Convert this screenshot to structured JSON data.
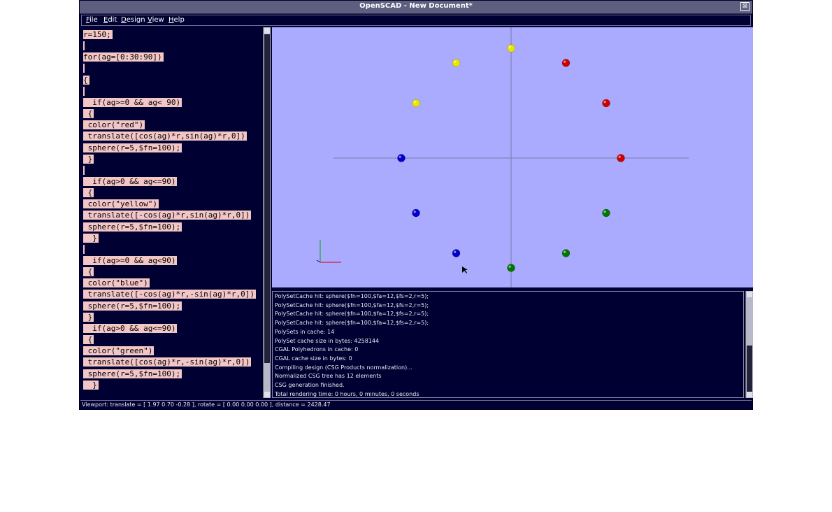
{
  "window": {
    "title": "OpenSCAD - New Document*",
    "close_symbol": "⊠"
  },
  "menu": [
    "File",
    "Edit",
    "Design",
    "View",
    "Help"
  ],
  "editor": {
    "lines": [
      "r=150;",
      "",
      "for(ag=[0:30:90])",
      "",
      "{",
      "",
      "  if(ag>=0 && ag< 90)",
      " {",
      " color(\"red\")",
      " translate([cos(ag)*r,sin(ag)*r,0])",
      " sphere(r=5,$fn=100);",
      " }",
      "",
      "  if(ag>0 && ag<=90)",
      " {",
      " color(\"yellow\")",
      " translate([-cos(ag)*r,sin(ag)*r,0])",
      " sphere(r=5,$fn=100);",
      "  }",
      "",
      "  if(ag>=0 && ag<90)",
      " {",
      " color(\"blue\")",
      " translate([-cos(ag)*r,-sin(ag)*r,0])",
      " sphere(r=5,$fn=100);",
      " }",
      "  if(ag>0 && ag<=90)",
      " {",
      " color(\"green\")",
      " translate([cos(ag)*r,-sin(ag)*r,0])",
      " sphere(r=5,$fn=100);",
      "  }"
    ]
  },
  "viewport": {
    "background": "#aaaaff",
    "spheres": [
      {
        "color": "red",
        "angle_deg": 0
      },
      {
        "color": "red",
        "angle_deg": 30
      },
      {
        "color": "red",
        "angle_deg": 60
      },
      {
        "color": "yellow",
        "angle_deg": 90
      },
      {
        "color": "yellow",
        "angle_deg": 120
      },
      {
        "color": "yellow",
        "angle_deg": 150
      },
      {
        "color": "blue",
        "angle_deg": 180
      },
      {
        "color": "blue",
        "angle_deg": 210
      },
      {
        "color": "blue",
        "angle_deg": 240
      },
      {
        "color": "green",
        "angle_deg": 270
      },
      {
        "color": "green",
        "angle_deg": 300
      },
      {
        "color": "green",
        "angle_deg": 330
      }
    ],
    "colors": {
      "red": "#cc0000",
      "yellow": "#e6e600",
      "blue": "#0000cc",
      "green": "#007700"
    }
  },
  "console": {
    "lines": [
      "PolySetCache hit: sphere($fn=100,$fa=12,$fs=2,r=5);",
      "PolySetCache hit: sphere($fn=100,$fa=12,$fs=2,r=5);",
      "PolySetCache hit: sphere($fn=100,$fa=12,$fs=2,r=5);",
      "PolySetCache hit: sphere($fn=100,$fa=12,$fs=2,r=5);",
      "PolySets in cache: 14",
      "PolySet cache size in bytes: 4258144",
      "CGAL Polyhedrons in cache: 0",
      "CGAL cache size in bytes: 0",
      "Compiling design (CSG Products normalization)...",
      "Normalized CSG tree has 12 elements",
      "CSG generation finished.",
      "Total rendering time: 0 hours, 0 minutes, 0 seconds"
    ]
  },
  "status": {
    "text": "Viewport: translate = [ 1.97 0.70 -0.28 ], rotate = [ 0.00 0.00 0.00 ], distance = 2428.47"
  }
}
